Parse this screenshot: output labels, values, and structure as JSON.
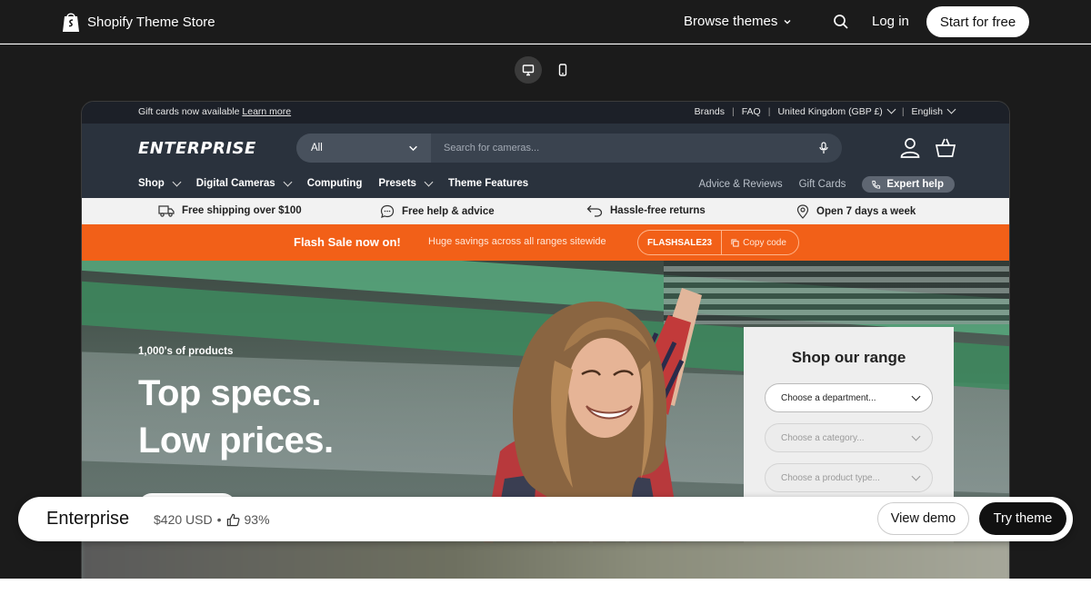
{
  "store_bar": {
    "logo_text": "Shopify Theme Store",
    "browse_label": "Browse themes",
    "login_label": "Log in",
    "start_label": "Start for free"
  },
  "preview": {
    "announcement": {
      "text": "Gift cards now available",
      "link": "Learn more",
      "brands": "Brands",
      "faq": "FAQ",
      "country": "United Kingdom (GBP £)",
      "language": "English"
    },
    "header": {
      "brand": "ENTERPRISE",
      "search_category": "All",
      "search_placeholder": "Search for cameras..."
    },
    "nav": {
      "items": [
        "Shop",
        "Digital Cameras",
        "Computing",
        "Presets",
        "Theme Features"
      ],
      "right": [
        "Advice & Reviews",
        "Gift Cards"
      ],
      "expert_help": "Expert help"
    },
    "usps": [
      "Free shipping over $100",
      "Free help & advice",
      "Hassle-free returns",
      "Open 7 days a week"
    ],
    "flash": {
      "title": "Flash Sale now on!",
      "subtitle": "Huge savings across all ranges sitewide",
      "code": "FLASHSALE23",
      "copy_label": "Copy code"
    },
    "hero": {
      "kicker": "1,000's of products",
      "line1": "Top specs.",
      "line2": "Low prices."
    },
    "range": {
      "title": "Shop our range",
      "department": "Choose a department...",
      "category": "Choose a category...",
      "product_type": "Choose a product type..."
    }
  },
  "theme_bar": {
    "name": "Enterprise",
    "price": "$420 USD",
    "bullet": "•",
    "rating": "93%",
    "view_demo": "View demo",
    "try_theme": "Try theme"
  },
  "colors": {
    "accent_orange": "#f26018",
    "header_bg": "#2a323d",
    "store_bg": "#1b1b1b"
  }
}
